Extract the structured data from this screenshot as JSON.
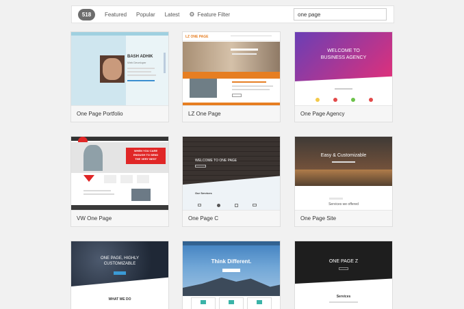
{
  "filter_bar": {
    "count": "518",
    "tabs": [
      "Featured",
      "Popular",
      "Latest"
    ],
    "feature_filter": "Feature Filter",
    "search_value": "one page"
  },
  "themes": [
    {
      "name": "One Page Portfolio",
      "shot": {
        "hero_name": "BASH ADHIK",
        "hero_role": "Web Developer"
      }
    },
    {
      "name": "LZ One Page",
      "shot": {
        "logo": "LZ ONE PAGE"
      }
    },
    {
      "name": "One Page Agency",
      "shot": {
        "headline_1": "WELCOME TO",
        "headline_2": "BUSINESS AGENCY"
      }
    },
    {
      "name": "VW One Page",
      "shot": {
        "banner_1": "WHEN YOU CARE",
        "banner_2": "ENOUGH TO SEND",
        "banner_3": "THE VERY BEST"
      }
    },
    {
      "name": "One Page C",
      "shot": {
        "headline": "WELCOME TO ONE PAGE",
        "section": "Our Services"
      }
    },
    {
      "name": "One Page Site",
      "shot": {
        "headline": "Easy & Customizable",
        "section": "Services we offered"
      }
    },
    {
      "name": "",
      "shot": {
        "headline_1": "ONE PAGE, HIGHLY",
        "headline_2": "CUSTOMIZABLE",
        "section": "WHAT WE DO"
      }
    },
    {
      "name": "",
      "shot": {
        "headline": "Think Different."
      }
    },
    {
      "name": "",
      "shot": {
        "headline": "ONE PAGE Z",
        "section": "Services"
      }
    }
  ],
  "colors": {
    "badge": "#6d6d6d",
    "orange": "#e67e22",
    "agency_gradient": [
      "#6a3fb5",
      "#e0307a"
    ],
    "vw_red": "#e02626",
    "dark_brick": "#3a3330"
  },
  "icons": [
    "gear-icon"
  ]
}
